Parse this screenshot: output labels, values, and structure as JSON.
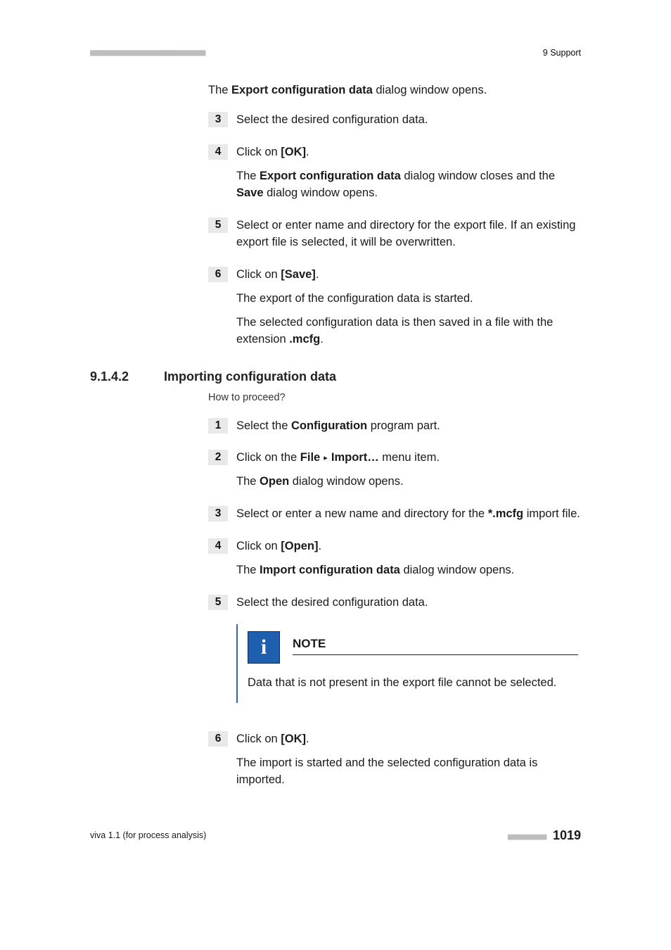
{
  "header": {
    "left_ticks": "■■■■■■■■■■■■■■■■■■■■■■",
    "right": "9 Support"
  },
  "intro": {
    "p1_pre": "The ",
    "p1_bold": "Export configuration data",
    "p1_post": " dialog window opens."
  },
  "section1_steps": {
    "s3": {
      "num": "3",
      "t1": "Select the desired configuration data."
    },
    "s4": {
      "num": "4",
      "t1_pre": "Click on ",
      "t1_bold": "[OK]",
      "t1_post": ".",
      "t2_pre": "The ",
      "t2_bold": "Export configuration data",
      "t2_mid": " dialog window closes and the ",
      "t2_bold2": "Save",
      "t2_post": " dialog window opens."
    },
    "s5": {
      "num": "5",
      "t1": "Select or enter name and directory for the export file. If an existing export file is selected, it will be overwritten."
    },
    "s6": {
      "num": "6",
      "t1_pre": "Click on ",
      "t1_bold": "[Save]",
      "t1_post": ".",
      "t2": "The export of the configuration data is started.",
      "t3_pre": "The selected configuration data is then saved in a file with the extension ",
      "t3_bold": ".mcfg",
      "t3_post": "."
    }
  },
  "section_header": {
    "number": "9.1.4.2",
    "title": "Importing configuration data"
  },
  "howto": "How to proceed?",
  "section2_steps": {
    "s1": {
      "num": "1",
      "t1_pre": "Select the ",
      "t1_bold": "Configuration",
      "t1_post": " program part."
    },
    "s2": {
      "num": "2",
      "t1_pre": "Click on the ",
      "t1_bold1": "File",
      "t1_sep": " ▸ ",
      "t1_bold2": "Import…",
      "t1_post": " menu item.",
      "t2_pre": "The ",
      "t2_bold": "Open",
      "t2_post": " dialog window opens."
    },
    "s3": {
      "num": "3",
      "t1_pre": "Select or enter a new name and directory for the ",
      "t1_bold": "*.mcfg",
      "t1_post": " import file."
    },
    "s4": {
      "num": "4",
      "t1_pre": "Click on ",
      "t1_bold": "[Open]",
      "t1_post": ".",
      "t2_pre": "The ",
      "t2_bold": "Import configuration data",
      "t2_post": " dialog window opens."
    },
    "s5": {
      "num": "5",
      "t1": "Select the desired configuration data."
    },
    "note": {
      "title": "NOTE",
      "icon": "i",
      "body": "Data that is not present in the export file cannot be selected."
    },
    "s6": {
      "num": "6",
      "t1_pre": "Click on ",
      "t1_bold": "[OK]",
      "t1_post": ".",
      "t2": "The import is started and the selected configuration data is imported."
    }
  },
  "footer": {
    "left": "viva 1.1 (for process analysis)",
    "ticks": "■■■■■■■■",
    "page": "1019"
  }
}
